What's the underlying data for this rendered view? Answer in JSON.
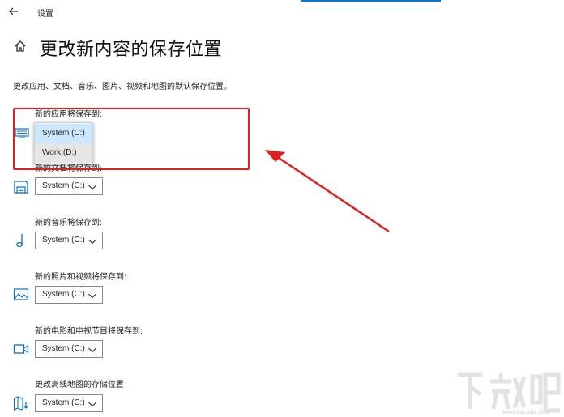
{
  "window": {
    "title": "设置",
    "accent_color": "#0078d7"
  },
  "header": {
    "page_title": "更改新内容的保存位置"
  },
  "description": "更改应用、文档、音乐、图片、视频和地图的默认保存位置。",
  "sections": [
    {
      "label": "新的应用将保存到:",
      "icon": "monitor-keyboard-icon",
      "value": "System (C:)"
    },
    {
      "label": "新的文档将保存到:",
      "icon": "document-drive-icon",
      "value": "System (C:)"
    },
    {
      "label": "新的音乐将保存到:",
      "icon": "music-note-icon",
      "value": "System (C:)"
    },
    {
      "label": "新的照片和视频将保存到:",
      "icon": "picture-icon",
      "value": "System (C:)"
    },
    {
      "label": "新的电影和电视节目将保存到:",
      "icon": "video-camera-icon",
      "value": "System (C:)"
    },
    {
      "label": "更改离线地图的存储位置",
      "icon": "map-download-icon",
      "value": "System (C:)"
    }
  ],
  "dropdown": {
    "options": [
      "System (C:)",
      "Work (D:)"
    ],
    "selected": "System (C:)"
  },
  "annotation": {
    "color": "#e02020"
  },
  "watermark": {
    "url": "www.xiazaiba.com"
  }
}
